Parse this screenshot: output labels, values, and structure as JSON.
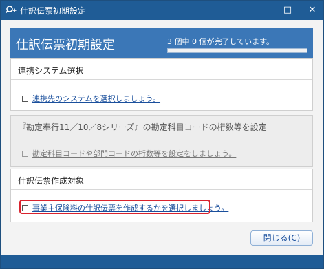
{
  "window": {
    "title": "仕訳伝票初期設定",
    "minimize_glyph": "–",
    "maximize_glyph": "□",
    "close_glyph": "✕",
    "app_icon": "search-plus-icon"
  },
  "header": {
    "title": "仕訳伝票初期設定",
    "progress_text": "3 個中 0 個が完了しています。",
    "progress_completed": 0,
    "progress_total": 3
  },
  "sections": [
    {
      "title": "連携システム選択",
      "task": "連携先のシステムを選択しましょう。",
      "enabled": true
    },
    {
      "title": "『勘定奉行11／10／8シリーズ』の勘定科目コードの桁数等を設定",
      "task": "勘定科目コードや部門コードの桁数等を設定をしましょう。",
      "enabled": false
    },
    {
      "title": "仕訳伝票作成対象",
      "task": "事業主保険料の仕訳伝票を作成するかを選択しましょう。",
      "enabled": true,
      "highlighted": true
    }
  ],
  "footer": {
    "close_label": "閉じる(C)"
  },
  "colors": {
    "titlebar": "#1f5c96",
    "header": "#3b77b7",
    "link": "#1a4f9c",
    "highlight": "#d9232e"
  }
}
